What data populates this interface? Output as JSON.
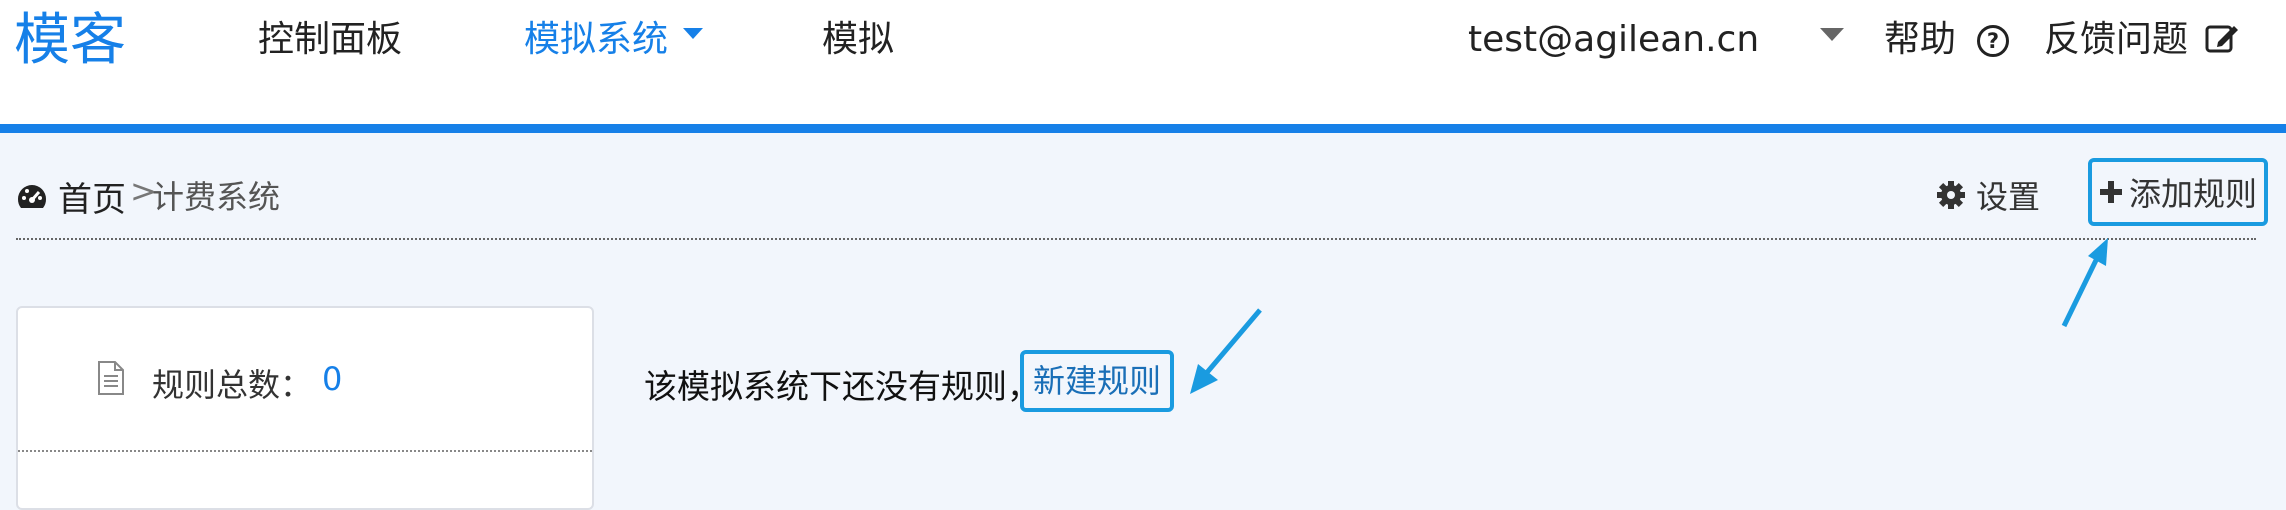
{
  "navbar": {
    "logo": "模客",
    "links": [
      {
        "label": "控制面板"
      },
      {
        "label": "模拟系统"
      },
      {
        "label": "模拟"
      }
    ],
    "user_email": "test@agilean.cn",
    "help_label": "帮助",
    "feedback_label": "反馈问题"
  },
  "breadcrumb": {
    "home_label": "首页",
    "separator": ">",
    "current": "计费系统"
  },
  "toolbar": {
    "settings_label": "设置",
    "add_rule_label": "添加规则"
  },
  "stats": {
    "total_rules_label": "规则总数：",
    "total_rules_value": "0"
  },
  "empty_state": {
    "message": "该模拟系统下还没有规则，",
    "new_rule_link": "新建规则"
  },
  "colors": {
    "brand": "#1680e8",
    "highlight": "#1a9be0",
    "background": "#f2f6fc"
  },
  "icons": {
    "dashboard": "dashboard-icon",
    "settings": "gear-icon",
    "add": "plus-icon",
    "help": "question-circle-icon",
    "feedback": "edit-icon",
    "stats": "document-icon"
  }
}
